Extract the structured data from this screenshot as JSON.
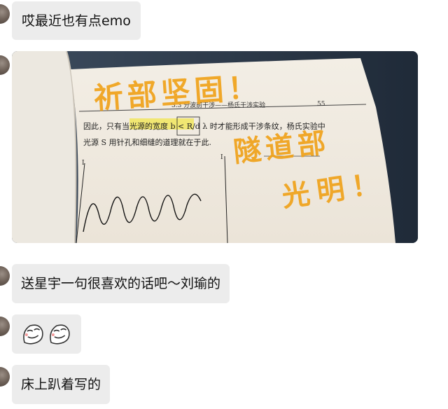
{
  "messages": [
    {
      "type": "text",
      "text": "哎最近也有点emo"
    },
    {
      "type": "image",
      "book": {
        "header": "3.3 分波前干涉——杨氏干涉实验",
        "page_number": "55",
        "line1": "因此，只有当光源的宽度 b < R/d λ 时才能形成干涉条纹，杨氏实验中",
        "line2": "光源 S 用针孔和细缝的道理就在于此.",
        "axis_i_left": "I",
        "axis_i_right": "I"
      },
      "handwriting": {
        "line1": "祈部坚固！",
        "line2": "隧道部",
        "line3": "光明！",
        "color": "#f0a21a"
      }
    },
    {
      "type": "text",
      "text": "送星宇一句很喜欢的话吧～刘瑜的"
    },
    {
      "type": "stickers",
      "icons": [
        "smirk-face-sticker",
        "smirk-face-sticker"
      ]
    },
    {
      "type": "text",
      "text": "床上趴着写的"
    }
  ]
}
